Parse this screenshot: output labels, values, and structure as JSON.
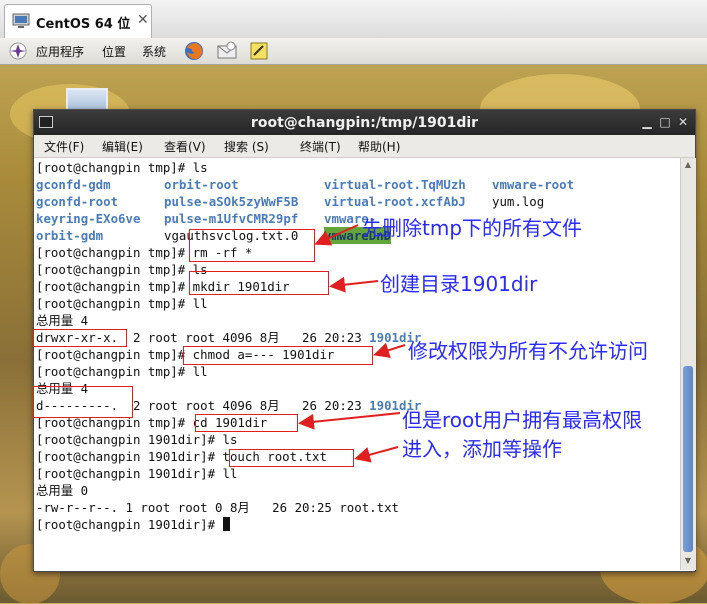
{
  "vm_tab": {
    "label": "CentOS 64 位",
    "close": "✕"
  },
  "panel": {
    "applications": "应用程序",
    "places": "位置",
    "system": "系统"
  },
  "terminal": {
    "title": "root@changpin:/tmp/1901dir",
    "menu": [
      "文件(F)",
      "编辑(E)",
      "查看(V)",
      "搜索 (S)",
      "终端(T)",
      "帮助(H)"
    ],
    "lines": {
      "l1": "[root@changpin tmp]# ls",
      "l2a": "gconfd-gdm",
      "l2b": "orbit-root",
      "l2c": "virtual-root.TqMUzh",
      "l2d": "vmware-root",
      "l3a": "gconfd-root",
      "l3b": "pulse-aSOk5zyWwF5B",
      "l3c": "virtual-root.xcfAbJ",
      "l3d": "yum.log",
      "l4a": "keyring-EXo6ve",
      "l4b": "pulse-m1UfvCMR29pf",
      "l4c": "vmware-",
      "l5a": "orbit-gdm",
      "l5b": "vgauthsvclog.txt.0",
      "l5c": "vmwareDnD",
      "l6": "[root@changpin tmp]# rm -rf *",
      "l7": "[root@changpin tmp]# ls",
      "l8": "[root@changpin tmp]# mkdir 1901dir",
      "l9": "[root@changpin tmp]# ll",
      "l10": "总用量 4",
      "l11a": "drwxr-xr-x.  2 root root 4096 8月   26 20:23 ",
      "l11b": "1901dir",
      "l12": "[root@changpin tmp]# chmod a=--- 1901dir",
      "l13": "[root@changpin tmp]# ll",
      "l14": "总用量 4",
      "l15a": "d---------.  2 root root 4096 8月   26 20:23 ",
      "l15b": "1901dir",
      "l16": "[root@changpin tmp]# cd 1901dir",
      "l17": "[root@changpin 1901dir]# ls",
      "l18": "[root@changpin 1901dir]# touch root.txt",
      "l19": "[root@changpin 1901dir]# ll",
      "l20": "总用量 0",
      "l21": "-rw-r--r--. 1 root root 0 8月   26 20:25 root.txt",
      "l22": "[root@changpin 1901dir]# "
    }
  },
  "annotations": {
    "a1": "先删除tmp下的所有文件",
    "a2": "创建目录1901dir",
    "a3": "修改权限为所有不允许访问",
    "a4": "但是root用户拥有最高权限",
    "a5": "进入，添加等操作"
  },
  "colors": {
    "annotation_text": "#2a2aff",
    "annotation_box": "#e02020",
    "dir_blue": "#4a7cb8"
  }
}
